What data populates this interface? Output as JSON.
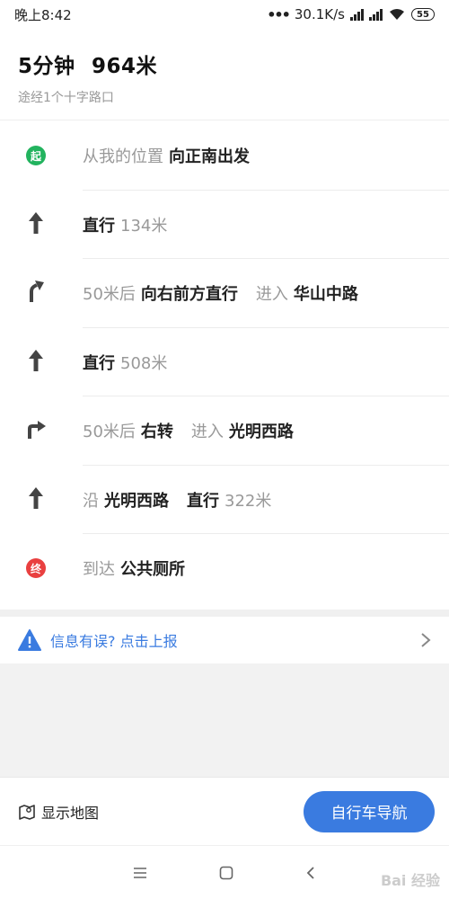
{
  "status_bar": {
    "time": "晚上8:42",
    "speed": "30.1K/s",
    "battery": "55"
  },
  "summary": {
    "duration": "5分钟",
    "distance": "964米",
    "subtitle": "途经1个十字路口"
  },
  "steps": [
    {
      "icon": "start-badge",
      "badge_text": "起",
      "parts": [
        {
          "t": "从我的位置"
        },
        {
          "t": "向正南出发",
          "b": true
        }
      ]
    },
    {
      "icon": "straight-arrow-icon",
      "parts": [
        {
          "t": "直行",
          "b": true
        },
        {
          "t": "134米"
        }
      ]
    },
    {
      "icon": "bear-right-arrow-icon",
      "parts": [
        {
          "t": "50米后"
        },
        {
          "t": "向右前方直行",
          "b": true
        },
        {
          "t": "进入",
          "gap": true
        },
        {
          "t": "华山中路",
          "b": true
        }
      ]
    },
    {
      "icon": "straight-arrow-icon",
      "parts": [
        {
          "t": "直行",
          "b": true
        },
        {
          "t": "508米"
        }
      ]
    },
    {
      "icon": "turn-right-arrow-icon",
      "parts": [
        {
          "t": "50米后"
        },
        {
          "t": "右转",
          "b": true
        },
        {
          "t": "进入",
          "gap": true
        },
        {
          "t": "光明西路",
          "b": true
        }
      ]
    },
    {
      "icon": "straight-arrow-icon",
      "parts": [
        {
          "t": "沿"
        },
        {
          "t": "光明西路",
          "b": true
        },
        {
          "t": "直行",
          "b": true,
          "gap": true
        },
        {
          "t": "322米"
        }
      ]
    },
    {
      "icon": "end-badge",
      "badge_text": "终",
      "parts": [
        {
          "t": "到达"
        },
        {
          "t": "公共厕所",
          "b": true
        }
      ]
    }
  ],
  "report": {
    "label": "信息有误? 点击上报"
  },
  "bottom": {
    "map_label": "显示地图",
    "nav_label": "自行车导航"
  },
  "colors": {
    "accent": "#3a7be0",
    "start": "#22b35e",
    "end": "#e94040"
  },
  "watermark": "Bai 经验"
}
